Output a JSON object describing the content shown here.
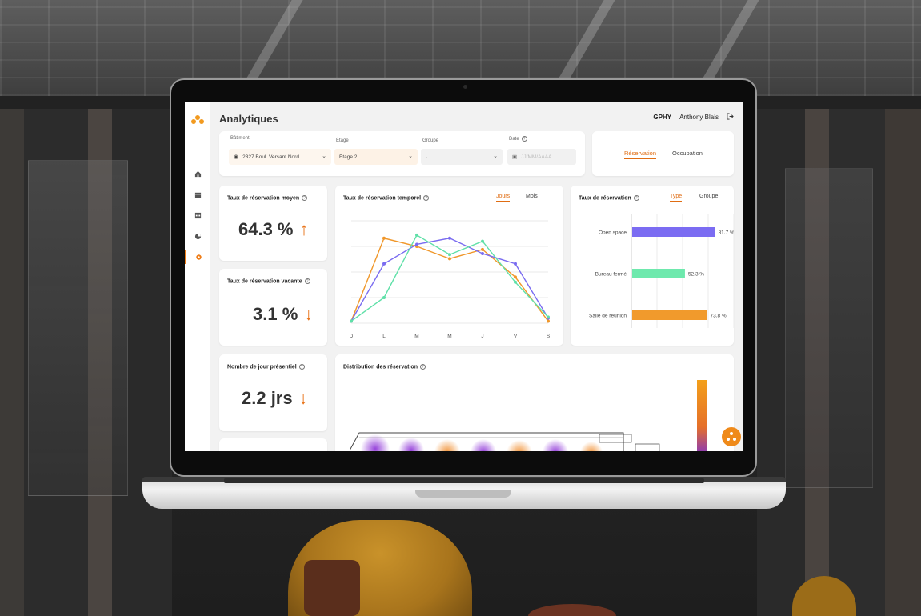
{
  "app": {
    "title": "Analytiques",
    "org": "GPHY",
    "user": "Anthony Blais"
  },
  "sidebar": {
    "items": [
      {
        "icon": "home-icon"
      },
      {
        "icon": "calendar-icon"
      },
      {
        "icon": "bookings-icon"
      },
      {
        "icon": "pie-chart-icon"
      },
      {
        "icon": "gear-icon",
        "active": true
      }
    ]
  },
  "filters": {
    "batiment": {
      "label": "Bâtiment",
      "value": "2327 Boul. Versant Nord"
    },
    "etage": {
      "label": "Étage",
      "value": "Étage 2"
    },
    "groupe": {
      "label": "Groupe",
      "value": "-"
    },
    "date": {
      "label": "Date",
      "placeholder": "JJ/MM/AAAA"
    }
  },
  "mode_tabs": {
    "active": "Réservation",
    "other": "Occupation"
  },
  "kpis": [
    {
      "label": "Taux de réservation moyen",
      "value": "64.3 %",
      "trend": "up"
    },
    {
      "label": "Taux de réservation vacante",
      "value": "3.1 %",
      "trend": "down"
    },
    {
      "label": "Nombre de jour présentiel",
      "value": "2.2 jrs",
      "trend": "down"
    }
  ],
  "temporal": {
    "title": "Taux de réservation temporel",
    "tab_active": "Jours",
    "tab_other": "Mois"
  },
  "types": {
    "title": "Taux de réservation",
    "tab_active": "Type",
    "tab_other": "Groupe"
  },
  "distribution": {
    "title": "Distribution des réservation"
  },
  "chart_data": [
    {
      "type": "line",
      "x": [
        "D",
        "L",
        "M",
        "M",
        "J",
        "V",
        "S"
      ],
      "ylim": [
        0,
        100
      ],
      "grid": true,
      "series": [
        {
          "color": "#f0972a",
          "values": [
            2,
            83,
            75,
            63,
            72,
            45,
            2
          ]
        },
        {
          "color": "#7a6cf0",
          "values": [
            2,
            58,
            77,
            83,
            68,
            58,
            5
          ]
        },
        {
          "color": "#5fe0a8",
          "values": [
            2,
            25,
            86,
            67,
            80,
            40,
            6
          ]
        }
      ]
    },
    {
      "type": "bar",
      "orientation": "horizontal",
      "categories": [
        "Open space",
        "Bureau fermé",
        "Salle de réunion"
      ],
      "values": [
        81.7,
        52.3,
        73.8
      ],
      "value_labels": [
        "81.7 %",
        "52.3 %",
        "73.8 %"
      ],
      "colors": [
        "#7b6cf2",
        "#6ee9ad",
        "#f19a2c"
      ],
      "xlim": [
        0,
        100
      ]
    }
  ]
}
